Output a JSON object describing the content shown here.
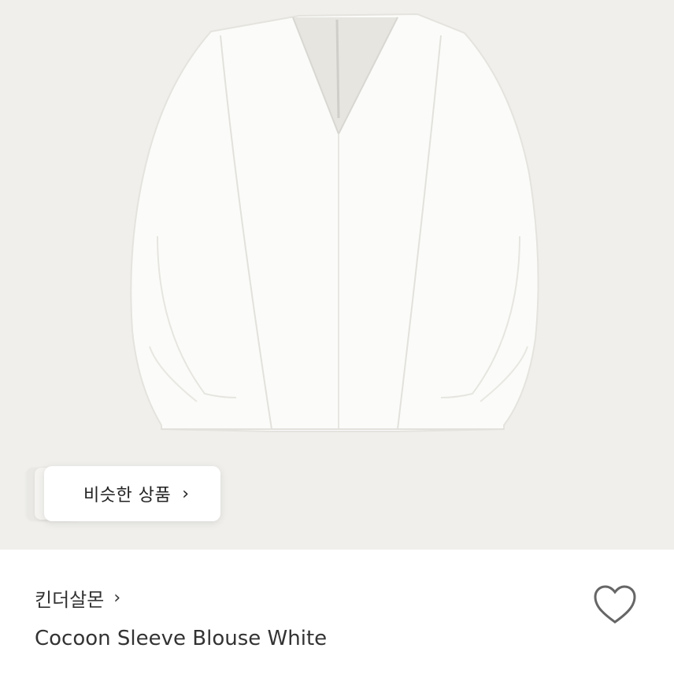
{
  "similar_products": {
    "label": "비슷한 상품",
    "chevron_icon": "chevron-right-icon"
  },
  "product": {
    "brand": "킨더살몬",
    "brand_chevron_icon": "chevron-right-icon",
    "title": "Cocoon Sleeve Blouse White",
    "like_icon": "heart-outline-icon"
  },
  "colors": {
    "hero_background": "#f0efeb",
    "text_primary": "#333333"
  }
}
